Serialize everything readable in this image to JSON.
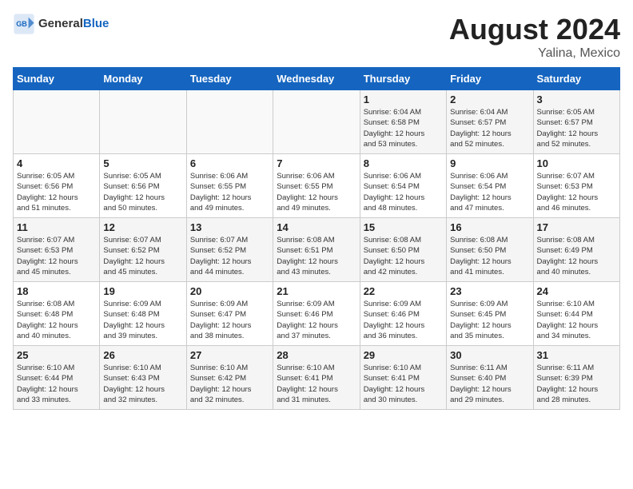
{
  "header": {
    "logo_general": "General",
    "logo_blue": "Blue",
    "month_year": "August 2024",
    "location": "Yalina, Mexico"
  },
  "weekdays": [
    "Sunday",
    "Monday",
    "Tuesday",
    "Wednesday",
    "Thursday",
    "Friday",
    "Saturday"
  ],
  "weeks": [
    [
      {
        "day": "",
        "info": ""
      },
      {
        "day": "",
        "info": ""
      },
      {
        "day": "",
        "info": ""
      },
      {
        "day": "",
        "info": ""
      },
      {
        "day": "1",
        "info": "Sunrise: 6:04 AM\nSunset: 6:58 PM\nDaylight: 12 hours\nand 53 minutes."
      },
      {
        "day": "2",
        "info": "Sunrise: 6:04 AM\nSunset: 6:57 PM\nDaylight: 12 hours\nand 52 minutes."
      },
      {
        "day": "3",
        "info": "Sunrise: 6:05 AM\nSunset: 6:57 PM\nDaylight: 12 hours\nand 52 minutes."
      }
    ],
    [
      {
        "day": "4",
        "info": "Sunrise: 6:05 AM\nSunset: 6:56 PM\nDaylight: 12 hours\nand 51 minutes."
      },
      {
        "day": "5",
        "info": "Sunrise: 6:05 AM\nSunset: 6:56 PM\nDaylight: 12 hours\nand 50 minutes."
      },
      {
        "day": "6",
        "info": "Sunrise: 6:06 AM\nSunset: 6:55 PM\nDaylight: 12 hours\nand 49 minutes."
      },
      {
        "day": "7",
        "info": "Sunrise: 6:06 AM\nSunset: 6:55 PM\nDaylight: 12 hours\nand 49 minutes."
      },
      {
        "day": "8",
        "info": "Sunrise: 6:06 AM\nSunset: 6:54 PM\nDaylight: 12 hours\nand 48 minutes."
      },
      {
        "day": "9",
        "info": "Sunrise: 6:06 AM\nSunset: 6:54 PM\nDaylight: 12 hours\nand 47 minutes."
      },
      {
        "day": "10",
        "info": "Sunrise: 6:07 AM\nSunset: 6:53 PM\nDaylight: 12 hours\nand 46 minutes."
      }
    ],
    [
      {
        "day": "11",
        "info": "Sunrise: 6:07 AM\nSunset: 6:53 PM\nDaylight: 12 hours\nand 45 minutes."
      },
      {
        "day": "12",
        "info": "Sunrise: 6:07 AM\nSunset: 6:52 PM\nDaylight: 12 hours\nand 45 minutes."
      },
      {
        "day": "13",
        "info": "Sunrise: 6:07 AM\nSunset: 6:52 PM\nDaylight: 12 hours\nand 44 minutes."
      },
      {
        "day": "14",
        "info": "Sunrise: 6:08 AM\nSunset: 6:51 PM\nDaylight: 12 hours\nand 43 minutes."
      },
      {
        "day": "15",
        "info": "Sunrise: 6:08 AM\nSunset: 6:50 PM\nDaylight: 12 hours\nand 42 minutes."
      },
      {
        "day": "16",
        "info": "Sunrise: 6:08 AM\nSunset: 6:50 PM\nDaylight: 12 hours\nand 41 minutes."
      },
      {
        "day": "17",
        "info": "Sunrise: 6:08 AM\nSunset: 6:49 PM\nDaylight: 12 hours\nand 40 minutes."
      }
    ],
    [
      {
        "day": "18",
        "info": "Sunrise: 6:08 AM\nSunset: 6:48 PM\nDaylight: 12 hours\nand 40 minutes."
      },
      {
        "day": "19",
        "info": "Sunrise: 6:09 AM\nSunset: 6:48 PM\nDaylight: 12 hours\nand 39 minutes."
      },
      {
        "day": "20",
        "info": "Sunrise: 6:09 AM\nSunset: 6:47 PM\nDaylight: 12 hours\nand 38 minutes."
      },
      {
        "day": "21",
        "info": "Sunrise: 6:09 AM\nSunset: 6:46 PM\nDaylight: 12 hours\nand 37 minutes."
      },
      {
        "day": "22",
        "info": "Sunrise: 6:09 AM\nSunset: 6:46 PM\nDaylight: 12 hours\nand 36 minutes."
      },
      {
        "day": "23",
        "info": "Sunrise: 6:09 AM\nSunset: 6:45 PM\nDaylight: 12 hours\nand 35 minutes."
      },
      {
        "day": "24",
        "info": "Sunrise: 6:10 AM\nSunset: 6:44 PM\nDaylight: 12 hours\nand 34 minutes."
      }
    ],
    [
      {
        "day": "25",
        "info": "Sunrise: 6:10 AM\nSunset: 6:44 PM\nDaylight: 12 hours\nand 33 minutes."
      },
      {
        "day": "26",
        "info": "Sunrise: 6:10 AM\nSunset: 6:43 PM\nDaylight: 12 hours\nand 32 minutes."
      },
      {
        "day": "27",
        "info": "Sunrise: 6:10 AM\nSunset: 6:42 PM\nDaylight: 12 hours\nand 32 minutes."
      },
      {
        "day": "28",
        "info": "Sunrise: 6:10 AM\nSunset: 6:41 PM\nDaylight: 12 hours\nand 31 minutes."
      },
      {
        "day": "29",
        "info": "Sunrise: 6:10 AM\nSunset: 6:41 PM\nDaylight: 12 hours\nand 30 minutes."
      },
      {
        "day": "30",
        "info": "Sunrise: 6:11 AM\nSunset: 6:40 PM\nDaylight: 12 hours\nand 29 minutes."
      },
      {
        "day": "31",
        "info": "Sunrise: 6:11 AM\nSunset: 6:39 PM\nDaylight: 12 hours\nand 28 minutes."
      }
    ]
  ]
}
